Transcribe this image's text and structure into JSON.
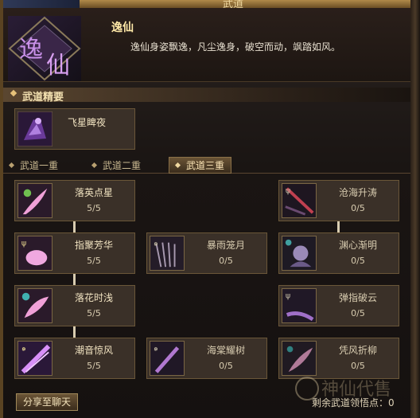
{
  "window": {
    "title": "武道"
  },
  "header": {
    "emblem_text": "逸仙",
    "title": "逸仙",
    "description": "逸仙身姿飘逸，凡尘逸身，破空而动，飒踏如风。"
  },
  "essence": {
    "section_label": "武道精要",
    "card_name": "飞星睥夜"
  },
  "tabs": [
    {
      "label": "武道一重"
    },
    {
      "label": "武道二重"
    },
    {
      "label": "武道三重"
    }
  ],
  "nodes": [
    {
      "name": "落英点星",
      "level": "5/5",
      "icon": "pink-feather-icon"
    },
    {
      "name": "沧海升涛",
      "level": "0/5",
      "icon": "red-spear-icon"
    },
    {
      "name": "指聚芳华",
      "level": "5/5",
      "icon": "pink-orb-icon"
    },
    {
      "name": "暴雨笼月",
      "level": "0/5",
      "icon": "rain-icon"
    },
    {
      "name": "渊心渐明",
      "level": "0/5",
      "icon": "spirit-icon"
    },
    {
      "name": "落花时浅",
      "level": "5/5",
      "icon": "pink-petal-icon"
    },
    {
      "name": "弹指破云",
      "level": "0/5",
      "icon": "purple-sweep-icon"
    },
    {
      "name": "潮音惊风",
      "level": "5/5",
      "icon": "purple-slash-icon"
    },
    {
      "name": "海棠耀树",
      "level": "0/5",
      "icon": "purple-streak-icon"
    },
    {
      "name": "凭风折柳",
      "level": "0/5",
      "icon": "pink-feather-dim-icon"
    }
  ],
  "footer": {
    "share_label": "分享至聊天",
    "remaining_label": "剩余武道领悟点：",
    "remaining_value": "0"
  },
  "colors": {
    "accent_gold": "#e6c27a",
    "panel_bg": "#1a1513",
    "card_bg": "#3a3028"
  }
}
